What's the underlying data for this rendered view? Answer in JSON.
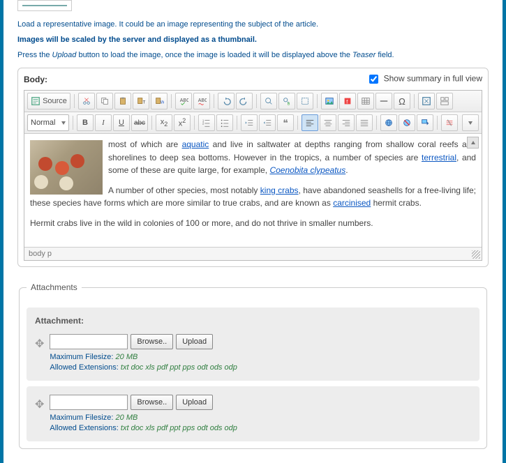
{
  "hints": {
    "line1": "Load a representative image. It could be an image representing the subject of the article.",
    "line2": "Images will be scaled by the server and displayed as a thumbnail.",
    "line3_pre": "Press the ",
    "line3_em1": "Upload",
    "line3_mid": " button to load the image, once the image is loaded it will be displayed above the ",
    "line3_em2": "Teaser",
    "line3_post": " field."
  },
  "body_label": "Body:",
  "summary_label": "Show summary in full view",
  "toolbar": {
    "source_label": "Source",
    "format_value": "Normal"
  },
  "content": {
    "p1_a": "most of which are ",
    "p1_link1": "aquatic",
    "p1_b": " and live in saltwater at depths ranging from shallow coral reefs and shorelines to deep sea bottoms. However in the tropics, a number of species are ",
    "p1_link2": "terrestrial",
    "p1_c": ", and some of these are quite large, for example, ",
    "p1_link3": "Coenobita clypeatus",
    "p1_d": ".",
    "p2_a": "A number of other species, most notably ",
    "p2_link1": "king crabs",
    "p2_b": ", have abandoned seashells for a free-living life; these species have forms which are more similar to true crabs, and are known as ",
    "p2_link2": "carcinised",
    "p2_c": " hermit crabs.",
    "p3": "Hermit crabs live in the wild in colonies of 100 or more, and do not thrive in smaller numbers."
  },
  "statusbar": "body  p",
  "attachments": {
    "legend": "Attachments",
    "label": "Attachment:",
    "browse": "Browse..",
    "upload": "Upload",
    "max_label": "Maximum Filesize: ",
    "max_val": "20 MB",
    "ext_label": "Allowed Extensions: ",
    "ext_val": "txt doc xls pdf ppt pps odt ods odp"
  }
}
